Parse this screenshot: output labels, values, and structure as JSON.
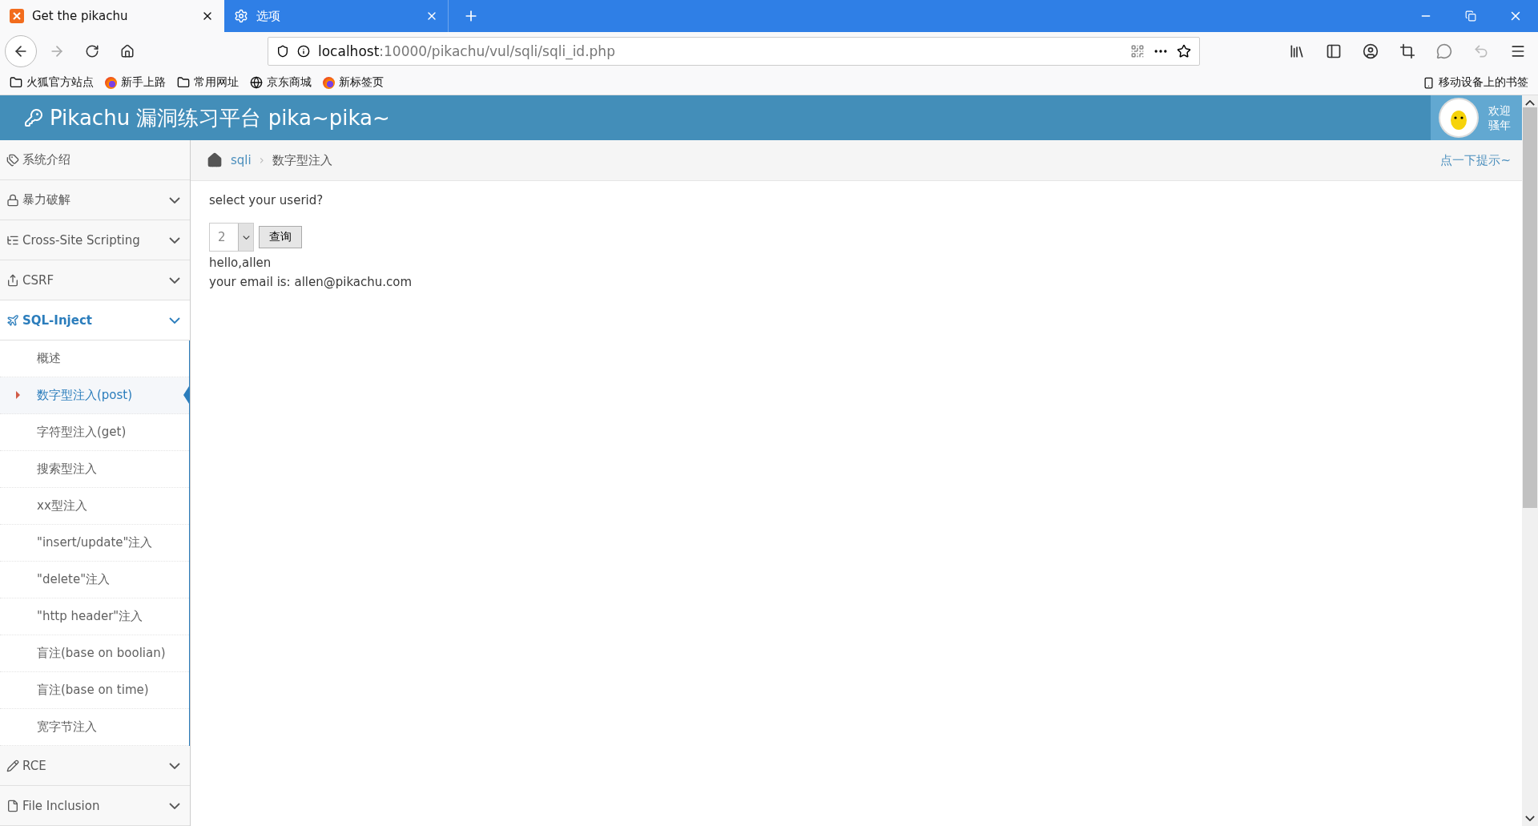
{
  "browser": {
    "tabs": [
      {
        "title": "Get the pikachu",
        "selected": true
      },
      {
        "title": "选项",
        "selected": false
      }
    ],
    "url_host": "localhost",
    "url_path": ":10000/pikachu/vul/sqli/sqli_id.php",
    "bookmarks": [
      {
        "label": "火狐官方站点"
      },
      {
        "label": "新手上路"
      },
      {
        "label": "常用网址"
      },
      {
        "label": "京东商城"
      },
      {
        "label": "新标签页"
      }
    ],
    "mobile_bookmarks": "移动设备上的书签"
  },
  "header": {
    "title": "Pikachu 漏洞练习平台 pika~pika~",
    "welcome": "欢迎",
    "user": "骚年"
  },
  "breadcrumb": {
    "section": "sqli",
    "separator": "›",
    "page": "数字型注入",
    "hint": "点一下提示~"
  },
  "sidebar": {
    "items": [
      {
        "label": "系统介绍",
        "expandable": false,
        "expanded": false
      },
      {
        "label": "暴力破解",
        "expandable": true,
        "expanded": false
      },
      {
        "label": "Cross-Site Scripting",
        "expandable": true,
        "expanded": false
      },
      {
        "label": "CSRF",
        "expandable": true,
        "expanded": false
      },
      {
        "label": "SQL-Inject",
        "expandable": true,
        "expanded": true,
        "children": [
          {
            "label": "概述",
            "selected": false
          },
          {
            "label": "数字型注入(post)",
            "selected": true
          },
          {
            "label": "字符型注入(get)",
            "selected": false
          },
          {
            "label": "搜索型注入",
            "selected": false
          },
          {
            "label": "xx型注入",
            "selected": false
          },
          {
            "label": "\"insert/update\"注入",
            "selected": false
          },
          {
            "label": "\"delete\"注入",
            "selected": false
          },
          {
            "label": "\"http header\"注入",
            "selected": false
          },
          {
            "label": "盲注(base on boolian)",
            "selected": false
          },
          {
            "label": "盲注(base on time)",
            "selected": false
          },
          {
            "label": "宽字节注入",
            "selected": false
          }
        ]
      },
      {
        "label": "RCE",
        "expandable": true,
        "expanded": false
      },
      {
        "label": "File Inclusion",
        "expandable": true,
        "expanded": false
      }
    ]
  },
  "content": {
    "prompt": "select your userid?",
    "select_value": "2",
    "query_button": "查询",
    "greeting": "hello,allen",
    "email": "your email is: allen@pikachu.com"
  }
}
